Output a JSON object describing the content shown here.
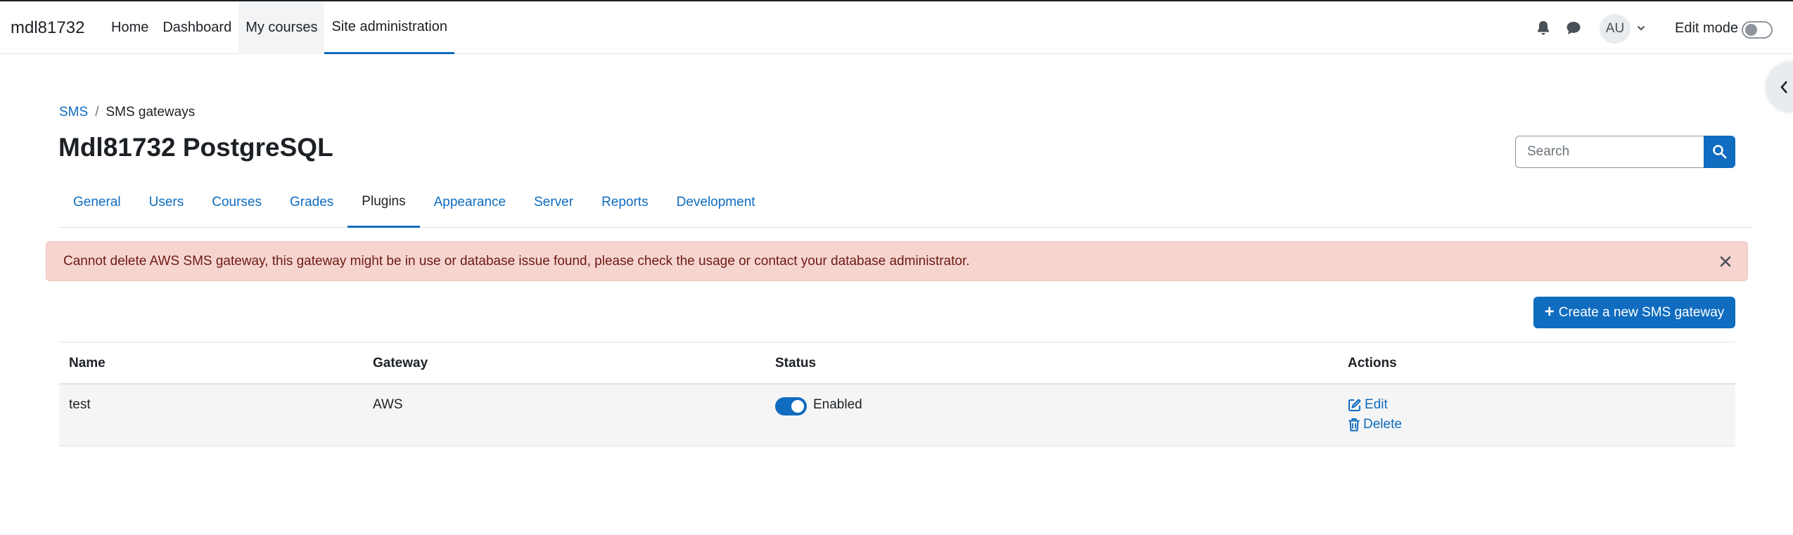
{
  "navbar": {
    "site_name": "mdl81732",
    "items": [
      {
        "label": "Home"
      },
      {
        "label": "Dashboard"
      },
      {
        "label": "My courses"
      },
      {
        "label": "Site administration"
      }
    ],
    "avatar_initials": "AU",
    "edit_mode_label": "Edit mode",
    "edit_mode_on": false
  },
  "breadcrumb": {
    "items": [
      "SMS",
      "SMS gateways"
    ],
    "separator": "/"
  },
  "page_title": "Mdl81732 PostgreSQL",
  "search": {
    "placeholder": "Search"
  },
  "secondary_nav": {
    "tabs": [
      {
        "label": "General"
      },
      {
        "label": "Users"
      },
      {
        "label": "Courses"
      },
      {
        "label": "Grades"
      },
      {
        "label": "Plugins"
      },
      {
        "label": "Appearance"
      },
      {
        "label": "Server"
      },
      {
        "label": "Reports"
      },
      {
        "label": "Development"
      }
    ],
    "active": "Plugins"
  },
  "alert": {
    "message": "Cannot delete AWS SMS gateway, this gateway might be in use or database issue found, please check the usage or contact your database administrator.",
    "type": "danger"
  },
  "create_button_label": "Create a new SMS gateway",
  "table": {
    "headers": {
      "name": "Name",
      "gateway": "Gateway",
      "status": "Status",
      "actions": "Actions"
    },
    "rows": [
      {
        "name": "test",
        "gateway": "AWS",
        "status": "Enabled",
        "enabled": true,
        "actions": {
          "edit": "Edit",
          "delete": "Delete"
        }
      }
    ]
  },
  "colors": {
    "primary": "#0f6cbf",
    "alert_bg": "#f6d5d1",
    "alert_text": "#6e1a12",
    "text": "#1d2125"
  },
  "icons": [
    "bell-icon",
    "chat-icon",
    "chevron-down-icon",
    "chevron-left-icon",
    "search-icon",
    "close-icon",
    "plus-icon",
    "edit-icon",
    "trash-icon"
  ]
}
